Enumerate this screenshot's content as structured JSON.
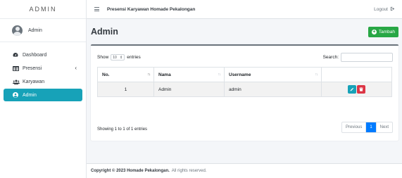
{
  "sidebar": {
    "brand": "ADMIN",
    "user": {
      "name": "Admin"
    },
    "items": [
      {
        "label": "Dashboard",
        "icon": "dashboard-icon",
        "active": false
      },
      {
        "label": "Presensi",
        "icon": "table-icon",
        "active": false,
        "has_submenu": true
      },
      {
        "label": "Karyawan",
        "icon": "users-icon",
        "active": false
      },
      {
        "label": "Admin",
        "icon": "user-circle-icon",
        "active": true
      }
    ]
  },
  "topbar": {
    "title": "Presensi Karyawan Homade Pekalongan",
    "logout_label": "Logout"
  },
  "main": {
    "page_title": "Admin",
    "add_button_label": "Tambah",
    "length": {
      "show": "Show",
      "value": "10",
      "entries": "entries"
    },
    "search_label": "Search:",
    "table": {
      "columns": [
        "No.",
        "Nama",
        "Username",
        ""
      ],
      "rows": [
        {
          "no": "1",
          "nama": "Admin",
          "username": "admin"
        }
      ]
    },
    "info": "Showing 1 to 1 of 1 entries",
    "pagination": {
      "previous": "Previous",
      "current": "1",
      "next": "Next"
    }
  },
  "footer": {
    "copyright": "Copyright © 2023 Homade Pekalongan.",
    "rights": "All rights reserved."
  },
  "colors": {
    "accent": "#17a2b8",
    "success": "#28a745",
    "danger": "#dc3545",
    "primary": "#007bff"
  }
}
